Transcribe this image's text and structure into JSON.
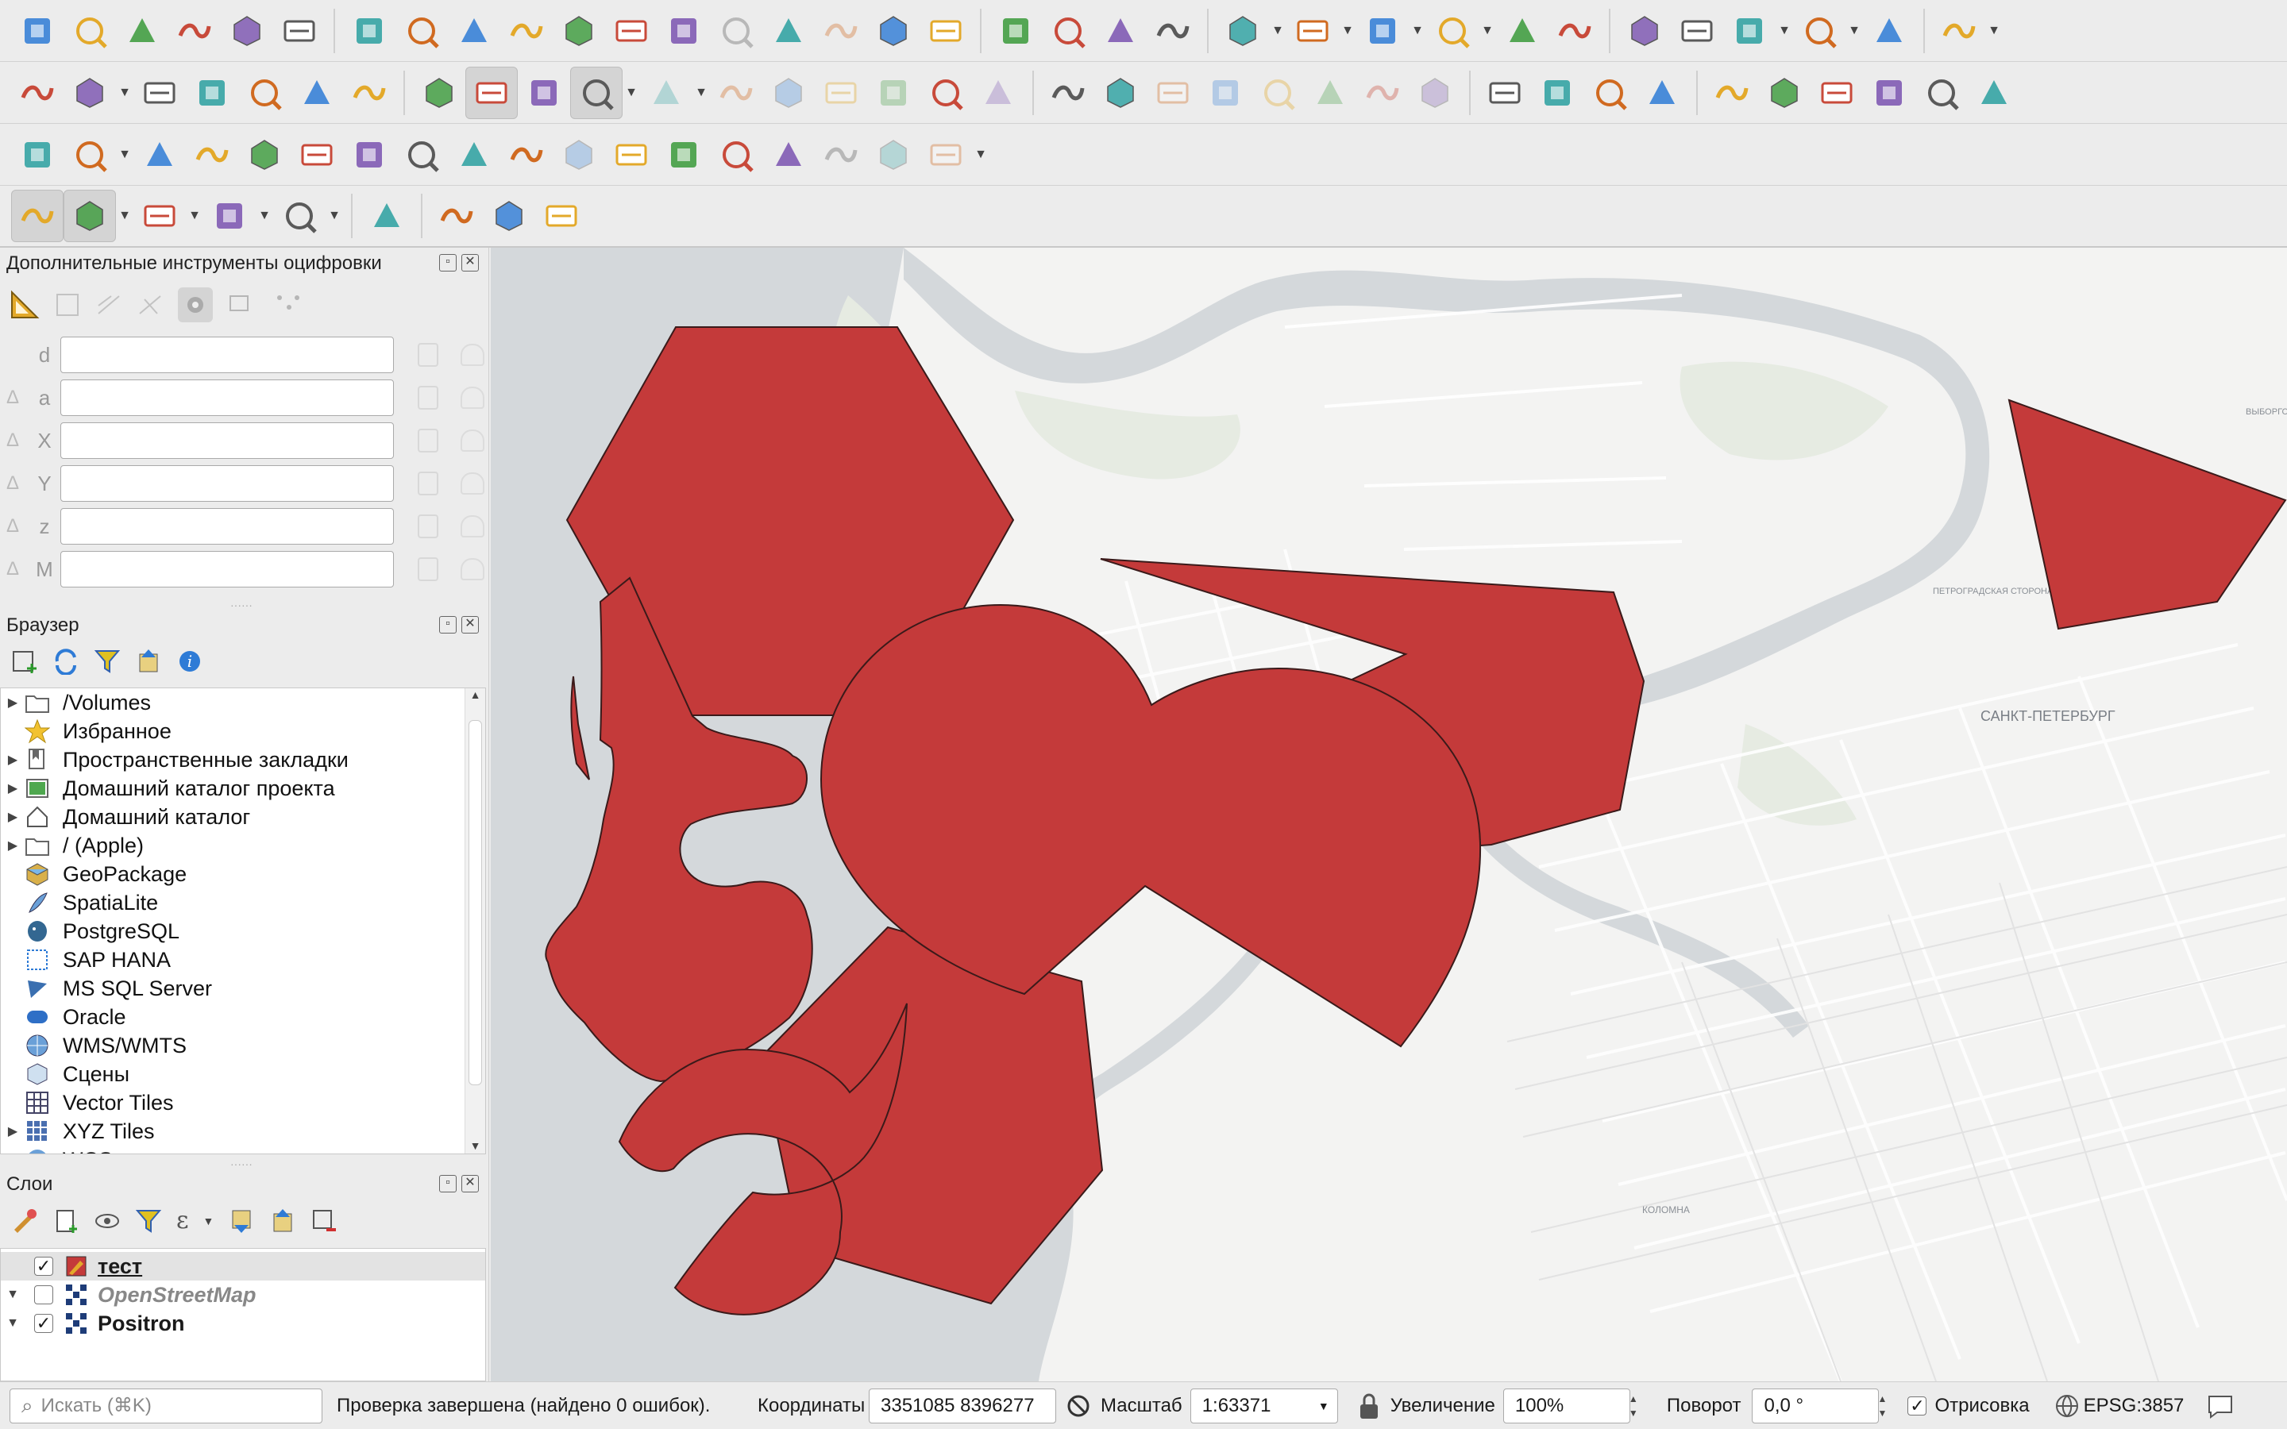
{
  "colors": {
    "polygon_fill": "#c43a3a",
    "polygon_stroke": "#3a1a1a",
    "water": "#d4d8db",
    "land": "#f3f3f2",
    "green": "#e6ebe2"
  },
  "toolbars": {
    "row1": [
      "new-project",
      "open-project",
      "save-project",
      "new-print-layout",
      "layout-manager",
      "style-manager",
      "pan-map",
      "pan-to-selection",
      "zoom-in",
      "zoom-out",
      "zoom-full",
      "zoom-to-selection",
      "zoom-to-layer",
      "zoom-native",
      "zoom-last",
      "zoom-next",
      "new-map-view",
      "new-3d-view",
      "new-bookmark",
      "show-bookmarks",
      "temporal-controller",
      "refresh",
      "select-features",
      "select-by-value",
      "deselect",
      "select-by-location",
      "identify",
      "attribute-statistics",
      "processing-toolbox",
      "statistical-summary",
      "open-attribute-table",
      "measure",
      "map-tips",
      "locate"
    ],
    "row2": [
      "new-layer",
      "digitize",
      "vertex-tool",
      "add-feature",
      "new-shapefile",
      "new-spatialite",
      "new-virtual-layer",
      "current-edits",
      "toggle-editing",
      "save-edits",
      "add-polygon",
      "modify-attributes",
      "delete-selected",
      "cut",
      "copy",
      "paste",
      "undo",
      "redo",
      "label-toolbar",
      "diagram",
      "pin-labels",
      "highlight-labels",
      "show-hide-labels",
      "move-label",
      "rotate-label",
      "change-label",
      "wms",
      "wfs",
      "gps",
      "metasearch",
      "python-console",
      "plugin-search",
      "plugin-manager",
      "3d-tool",
      "coordinate-capture",
      "help"
    ],
    "row3": [
      "advanced-digitizing",
      "move-feature",
      "rotate-feature",
      "simplify-feature",
      "add-ring",
      "add-part",
      "fill-ring",
      "delete-ring",
      "delete-part",
      "reshape",
      "offset-curve",
      "split-features",
      "split-parts",
      "merge-selected",
      "merge-attributes",
      "rotate-point-symbols",
      "offset-point",
      "trim-extend"
    ],
    "row4": [
      "enable-snapping",
      "snap-vertex",
      "snap-segment",
      "snap-area",
      "snap-intersection",
      "trace",
      "measure-angle",
      "zoom-to-feature",
      "color-picker"
    ]
  },
  "advanced_digitizing": {
    "title": "Дополнительные инструменты оцифровки",
    "fields": [
      {
        "label": "d",
        "value": ""
      },
      {
        "label": "a",
        "value": ""
      },
      {
        "label": "X",
        "value": ""
      },
      {
        "label": "Y",
        "value": ""
      },
      {
        "label": "z",
        "value": ""
      },
      {
        "label": "M",
        "value": ""
      }
    ]
  },
  "browser": {
    "title": "Браузер",
    "items": [
      {
        "label": "/Volumes",
        "icon": "folder-icon",
        "expandable": true
      },
      {
        "label": "Избранное",
        "icon": "star-icon",
        "expandable": false
      },
      {
        "label": "Пространственные закладки",
        "icon": "bookmark-icon",
        "expandable": true
      },
      {
        "label": "Домашний каталог проекта",
        "icon": "project-home-icon",
        "expandable": true
      },
      {
        "label": "Домашний каталог",
        "icon": "home-icon",
        "expandable": true
      },
      {
        "label": "/ (Apple)",
        "icon": "folder-icon",
        "expandable": true
      },
      {
        "label": "GeoPackage",
        "icon": "geopackage-icon",
        "expandable": false
      },
      {
        "label": "SpatiaLite",
        "icon": "spatialite-icon",
        "expandable": false
      },
      {
        "label": "PostgreSQL",
        "icon": "postgresql-icon",
        "expandable": false
      },
      {
        "label": "SAP HANA",
        "icon": "sap-hana-icon",
        "expandable": false
      },
      {
        "label": "MS SQL Server",
        "icon": "mssql-icon",
        "expandable": false
      },
      {
        "label": "Oracle",
        "icon": "oracle-icon",
        "expandable": false
      },
      {
        "label": "WMS/WMTS",
        "icon": "wms-icon",
        "expandable": false
      },
      {
        "label": "Сцены",
        "icon": "scenes-icon",
        "expandable": false
      },
      {
        "label": "Vector Tiles",
        "icon": "vector-tiles-icon",
        "expandable": false
      },
      {
        "label": "XYZ Tiles",
        "icon": "xyz-icon",
        "expandable": true
      },
      {
        "label": "WCS",
        "icon": "wcs-icon",
        "expandable": false
      }
    ]
  },
  "layers": {
    "title": "Слои",
    "items": [
      {
        "name": "тест",
        "checked": true,
        "style": "bold-underline",
        "icon": "polygon-layer-icon",
        "selected": true
      },
      {
        "name": "OpenStreetMap",
        "checked": false,
        "style": "italic",
        "icon": "raster-layer-icon",
        "selected": false
      },
      {
        "name": "Positron",
        "checked": true,
        "style": "bold",
        "icon": "raster-layer-icon",
        "selected": false
      }
    ]
  },
  "map_labels": [
    "САНКТ-ПЕТЕРБУРГ",
    "ПЕТРОГРАДСКАЯ СТОРОНА",
    "ВЫБОРГСКАЯ СТОРОНА",
    "КОЛОМНА"
  ],
  "status": {
    "search_placeholder": "Искать (⌘K)",
    "message": "Проверка завершена (найдено 0 ошибок).",
    "coord_label": "Координаты",
    "coord_value": "3351085  8396277",
    "scale_label": "Масштаб",
    "scale_value": "1:63371",
    "magnifier_label": "Увеличение",
    "magnifier_value": "100%",
    "rotation_label": "Поворот",
    "rotation_value": "0,0 °",
    "render_label": "Отрисовка",
    "render_checked": true,
    "crs": "EPSG:3857"
  }
}
